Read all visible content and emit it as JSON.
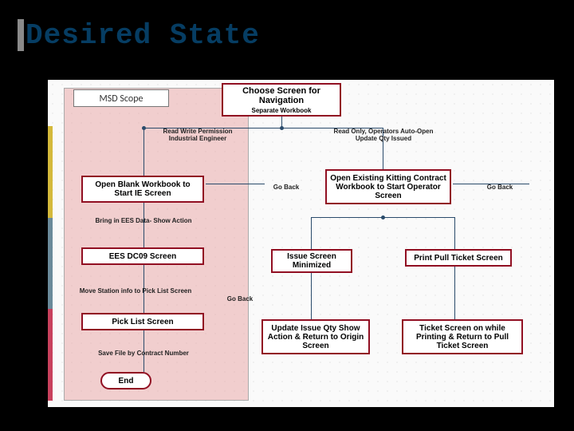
{
  "title": "Desired State",
  "scope_label": "MSD Scope",
  "chart_data": {
    "type": "table",
    "nodes": {
      "choose": {
        "label": "Choose Screen for Navigation",
        "sub": "Separate Workbook"
      },
      "open_blank": "Open Blank Workbook to Start IE Screen",
      "ees": "EES DC09 Screen",
      "picklist": "Pick List Screen",
      "end": "End",
      "open_kitting": "Open Existing Kitting Contract Workbook to Start Operator Screen",
      "issue_min": "Issue Screen Minimized",
      "print_pull": "Print Pull Ticket Screen",
      "update_issue": "Update Issue Qty Show Action & Return to Origin Screen",
      "ticket_on": "Ticket Screen on while Printing & Return to Pull Ticket Screen"
    },
    "edge_labels": {
      "rw": "Read Write Permission Industrial Engineer",
      "ro": "Read Only, Operators Auto-Open Update Qty Issued",
      "ees_action": "Bring in EES Data- Show Action",
      "move_station": "Move Station info to Pick List Screen",
      "save_file": "Save File by Contract Number",
      "go_back": "Go Back"
    }
  }
}
